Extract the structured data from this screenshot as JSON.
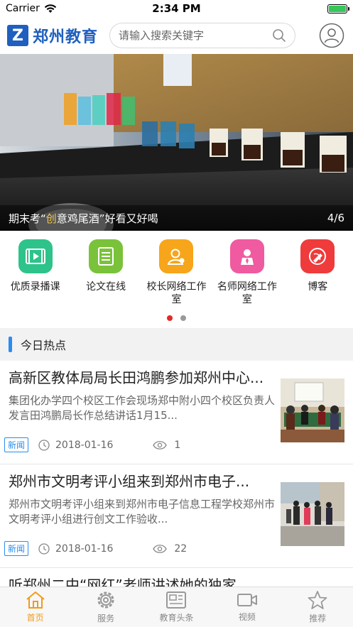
{
  "status": {
    "carrier": "Carrier",
    "time": "2:34 PM"
  },
  "header": {
    "logo_mark": "Z",
    "logo_text": "郑州教育",
    "search_placeholder": "请输入搜索关键字"
  },
  "banner": {
    "caption_prefix": "期末考“",
    "caption_highlight": "创",
    "caption_suffix": "意鸡尾酒”好看又好喝",
    "counter": "4/6",
    "highlight_color": "#f3c84a"
  },
  "shortcuts": [
    {
      "label": "优质录播课",
      "icon": "video-icon",
      "color": "#2ec38a"
    },
    {
      "label": "论文在线",
      "icon": "document-icon",
      "color": "#7ac23a"
    },
    {
      "label": "校长网络工作室",
      "icon": "principal-icon",
      "color": "#f7a51b"
    },
    {
      "label": "名师网络工作室",
      "icon": "teacher-icon",
      "color": "#f05aa0"
    },
    {
      "label": "博客",
      "icon": "blog-icon",
      "color": "#ef3b3b"
    }
  ],
  "shortcut_page": {
    "current": 1,
    "total": 2
  },
  "hot": {
    "title": "今日热点"
  },
  "news": [
    {
      "title": "高新区教体局局长田鸿鹏参加郑州中心...",
      "summary": "集团化办学四个校区工作会现场郑中附小四个校区负责人发言田鸿鹏局长作总结讲话1月15...",
      "tag": "新闻",
      "date": "2018-01-16",
      "views": "1"
    },
    {
      "title": "郑州市文明考评小组来到郑州市电子...",
      "summary": "郑州市文明考评小组来到郑州市电子信息工程学校郑州市文明考评小组进行创文工作验收...",
      "tag": "新闻",
      "date": "2018-01-16",
      "views": "22"
    },
    {
      "title": "听郑州二中“网红”老师讲述她的独家"
    }
  ],
  "tabs": [
    {
      "label": "首页",
      "icon": "home-icon",
      "active": true
    },
    {
      "label": "服务",
      "icon": "gear-icon",
      "active": false
    },
    {
      "label": "教育头条",
      "icon": "news-icon",
      "active": false
    },
    {
      "label": "视频",
      "icon": "video-camera-icon",
      "active": false
    },
    {
      "label": "推荐",
      "icon": "star-icon",
      "active": false
    }
  ],
  "colors": {
    "accent": "#1f5fbf",
    "tab_active": "#f39a1a",
    "tag_blue": "#2a8cef",
    "dot_active": "#e62727"
  }
}
